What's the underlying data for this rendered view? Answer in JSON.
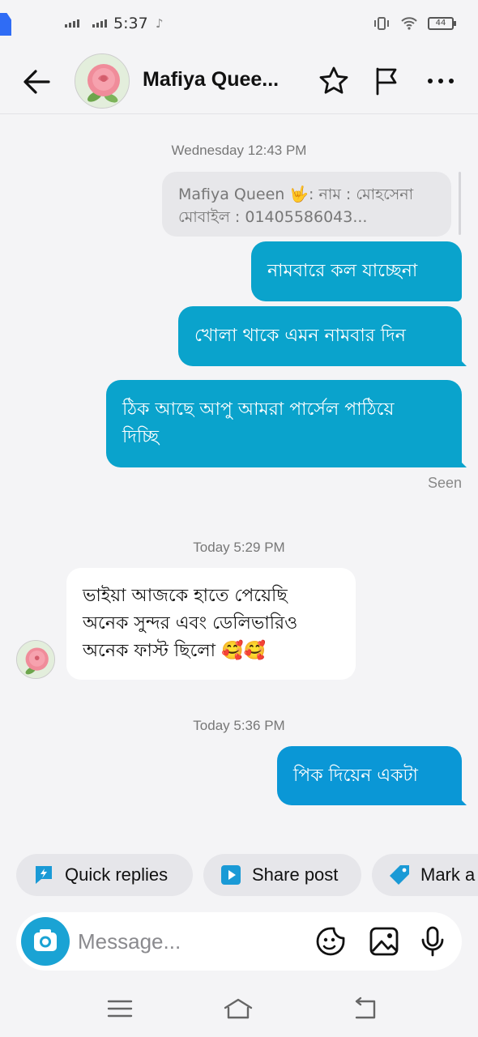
{
  "status_bar": {
    "time": "5:37",
    "battery": "44"
  },
  "header": {
    "contact_name": "Mafiya Quee...",
    "icons": [
      "back-arrow-icon",
      "star-icon",
      "flag-icon",
      "more-icon"
    ]
  },
  "conversation": {
    "timestamp_1": "Wednesday 12:43 PM",
    "quote_line_1": "Mafiya Queen 🤟: নাম : মোহসেনা",
    "quote_line_2": "মোবাইল : 01405586043...",
    "out_msg_1": "নামবারে কল যাচ্ছেনা",
    "out_msg_2": "খোলা থাকে এমন নামবার দিন",
    "out_msg_3_line_1": "ঠিক আছে আপু আমরা পার্সেল পাঠিয়ে",
    "out_msg_3_line_2": "দিচ্ছি",
    "seen": "Seen",
    "timestamp_2": "Today 5:29 PM",
    "in_msg_line_1": "ভাইয়া আজকে হাতে পেয়েছি",
    "in_msg_line_2": "অনেক সুন্দর এবং ডেলিভারিও",
    "in_msg_line_3": "অনেক ফাস্ট ছিলো 🥰🥰",
    "timestamp_3": "Today 5:36 PM",
    "out_msg_4": "পিক দিয়েন একটা"
  },
  "quick_actions": {
    "quick_replies": "Quick replies",
    "share_post": "Share post",
    "mark": "Mark a"
  },
  "composer": {
    "placeholder": "Message..."
  },
  "colors": {
    "outgoing_bubble": "#0aa3cc",
    "camera_button": "#1aa3d4",
    "accent_icon": "#1a9ad6"
  }
}
